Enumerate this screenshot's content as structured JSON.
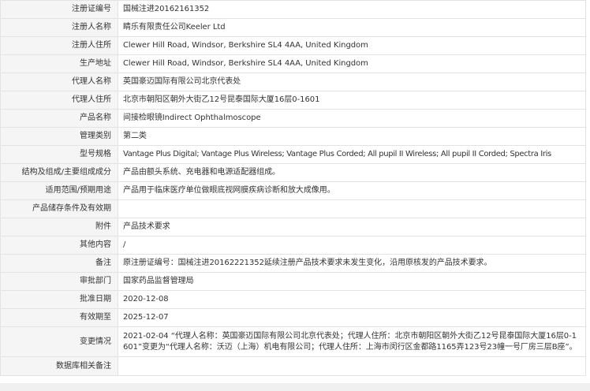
{
  "rows": [
    {
      "label": "注册证编号",
      "value": "国械注进20162161352"
    },
    {
      "label": "注册人名称",
      "value": "睛乐有限责任公司Keeler Ltd"
    },
    {
      "label": "注册人住所",
      "value": "Clewer Hill Road, Windsor, Berkshire SL4 4AA, United Kingdom"
    },
    {
      "label": "生产地址",
      "value": "Clewer Hill Road, Windsor, Berkshire SL4 4AA, United Kingdom"
    },
    {
      "label": "代理人名称",
      "value": "英国豪迈国际有限公司北京代表处"
    },
    {
      "label": "代理人住所",
      "value": "北京市朝阳区朝外大街乙12号昆泰国际大厦16层0-1601"
    },
    {
      "label": "产品名称",
      "value": "间接检眼镜Indirect Ophthalmoscope"
    },
    {
      "label": "管理类别",
      "value": "第二类"
    },
    {
      "label": "型号规格",
      "value": "Vantage Plus Digital; Vantage Plus Wireless; Vantage Plus Corded; All pupil II Wireless; All pupil II Corded; Spectra Iris"
    },
    {
      "label": "结构及组成/主要组成成分",
      "value": "产品由额头系统、充电器和电源适配器组成。"
    },
    {
      "label": "适用范围/预期用途",
      "value": "产品用于临床医疗单位做眼底视网膜疾病诊断和放大成像用。"
    },
    {
      "label": "产品储存条件及有效期",
      "value": ""
    },
    {
      "label": "附件",
      "value": "产品技术要求"
    },
    {
      "label": "其他内容",
      "value": "/"
    },
    {
      "label": "备注",
      "value": "原注册证编号：国械注进20162221352延续注册产品技术要求未发生变化，沿用原核发的产品技术要求。"
    },
    {
      "label": "审批部门",
      "value": "国家药品监督管理局"
    },
    {
      "label": "批准日期",
      "value": "2020-12-08"
    },
    {
      "label": "有效期至",
      "value": "2025-12-07"
    },
    {
      "label": "变更情况",
      "value": "2021-02-04 “代理人名称：英国豪迈国际有限公司北京代表处；代理人住所：北京市朝阳区朝外大街乙12号昆泰国际大厦16层0-1601”变更为“代理人名称：沃迈（上海）机电有限公司；代理人住所：上海市闵行区金都路1165弄123号23幢一号厂房三层B座”。"
    },
    {
      "label": "数据库相关备注",
      "value": ""
    }
  ]
}
